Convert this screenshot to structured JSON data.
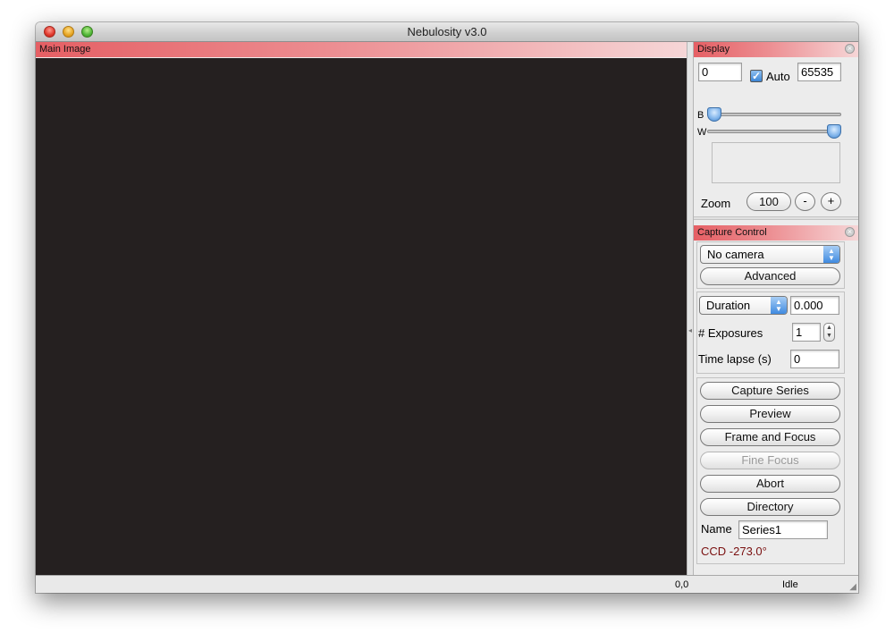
{
  "window": {
    "title": "Nebulosity v3.0"
  },
  "main_image": {
    "header": "Main Image"
  },
  "status_bar": {
    "coords": "0,0",
    "state": "Idle"
  },
  "display": {
    "header": "Display",
    "black_value": "0",
    "auto_label": "Auto",
    "auto_checked": true,
    "white_value": "65535",
    "b_label": "B",
    "w_label": "W",
    "b_level": 0.0,
    "w_level": 1.0,
    "zoom_label": "Zoom",
    "zoom_value": "100",
    "zoom_out": "-",
    "zoom_in": "+"
  },
  "capture": {
    "header": "Capture Control",
    "camera": "No camera",
    "advanced": "Advanced",
    "duration_mode": "Duration",
    "duration_value": "0.000",
    "exposures_label": "# Exposures",
    "exposures_value": "1",
    "timelapse_label": "Time lapse (s)",
    "timelapse_value": "0",
    "buttons": {
      "capture_series": "Capture Series",
      "preview": "Preview",
      "frame_focus": "Frame and Focus",
      "fine_focus": "Fine Focus",
      "abort": "Abort",
      "directory": "Directory"
    },
    "name_label": "Name",
    "name_value": "Series1",
    "ccd_temp": "CCD -273.0°"
  },
  "colors": {
    "panel_header": "#e55f64",
    "canvas": "#252020",
    "ccd_text": "#7a1010",
    "accent": "#3f8ae0"
  }
}
